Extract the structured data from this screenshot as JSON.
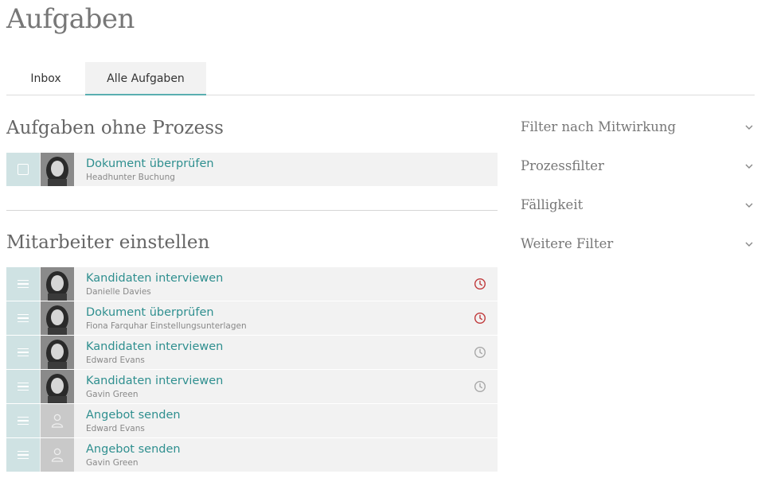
{
  "page": {
    "title": "Aufgaben"
  },
  "tabs": [
    {
      "label": "Inbox",
      "active": false
    },
    {
      "label": "Alle Aufgaben",
      "active": true
    }
  ],
  "sections": [
    {
      "title": "Aufgaben ohne Prozess",
      "tasks": [
        {
          "title": "Dokument überprüfen",
          "subtitle": "Headhunter Buchung",
          "handle": "checkbox",
          "avatar": "photo",
          "due": ""
        }
      ]
    },
    {
      "title": "Mitarbeiter einstellen",
      "tasks": [
        {
          "title": "Kandidaten interviewen",
          "subtitle": "Danielle Davies",
          "handle": "drag",
          "avatar": "photo",
          "due": "overdue"
        },
        {
          "title": "Dokument überprüfen",
          "subtitle": "Fiona Farquhar Einstellungsunterlagen",
          "handle": "drag",
          "avatar": "photo",
          "due": "overdue"
        },
        {
          "title": "Kandidaten interviewen",
          "subtitle": "Edward Evans",
          "handle": "drag",
          "avatar": "photo",
          "due": "normal"
        },
        {
          "title": "Kandidaten interviewen",
          "subtitle": "Gavin Green",
          "handle": "drag",
          "avatar": "photo",
          "due": "normal"
        },
        {
          "title": "Angebot senden",
          "subtitle": "Edward Evans",
          "handle": "drag",
          "avatar": "placeholder",
          "due": ""
        },
        {
          "title": "Angebot senden",
          "subtitle": "Gavin Green",
          "handle": "drag",
          "avatar": "placeholder",
          "due": ""
        }
      ]
    }
  ],
  "filters": [
    {
      "label": "Filter nach Mitwirkung"
    },
    {
      "label": "Prozessfilter"
    },
    {
      "label": "Fälligkeit"
    },
    {
      "label": "Weitere Filter"
    }
  ],
  "colors": {
    "accent": "#2f8f8f",
    "overdue": "#c0393b",
    "clock_normal": "#a8a8a8"
  }
}
